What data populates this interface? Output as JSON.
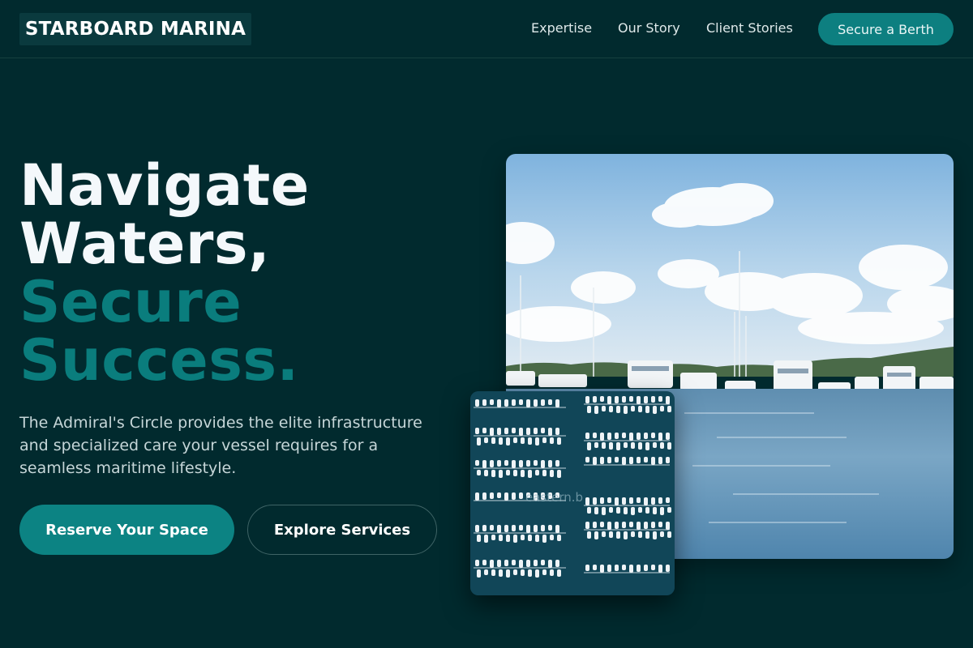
{
  "header": {
    "logo_text": "STARBOARD MARINA",
    "nav": [
      {
        "label": "Expertise"
      },
      {
        "label": "Our Story"
      },
      {
        "label": "Client Stories"
      }
    ],
    "cta_label": "Secure a Berth"
  },
  "hero": {
    "headline_line1": "Navigate",
    "headline_line2": "Waters,",
    "headline_line3": "Secure",
    "headline_line4": "Success.",
    "description": "The Admiral's Circle provides the elite infrastructure and specialized care your vessel requires for a seamless maritime lifestyle.",
    "primary_button": "Reserve Your Space",
    "secondary_button": "Explore Services",
    "image_watermark": "eastern.b"
  },
  "colors": {
    "background": "#012a2e",
    "accent": "#0c8383",
    "headline_accent": "#0a7d7d"
  }
}
